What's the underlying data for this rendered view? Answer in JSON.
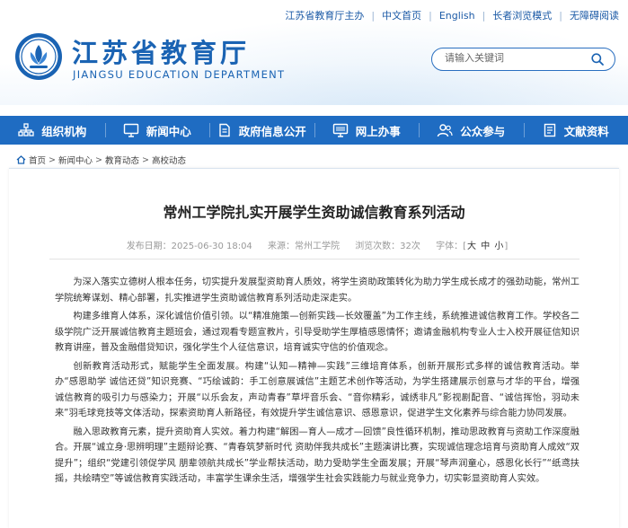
{
  "header": {
    "toplinks": [
      "江苏省教育厅主办",
      "中文首页",
      "English",
      "长者浏览模式",
      "无障碍阅读"
    ],
    "title_cn": "江苏省教育厅",
    "title_en": "JIANGSU EDUCATION DEPARTMENT",
    "search_placeholder": "请输入关键词"
  },
  "nav": {
    "items": [
      {
        "label": "组织机构",
        "icon": "org-chart-icon"
      },
      {
        "label": "新闻中心",
        "icon": "monitor-icon"
      },
      {
        "label": "政府信息公开",
        "icon": "document-icon"
      },
      {
        "label": "网上办事",
        "icon": "screen-icon"
      },
      {
        "label": "公众参与",
        "icon": "people-icon"
      },
      {
        "label": "文献资料",
        "icon": "book-icon"
      }
    ]
  },
  "breadcrumb": {
    "items": [
      "首页",
      "新闻中心",
      "教育动态",
      "高校动态"
    ],
    "separator": ">"
  },
  "article": {
    "title": "常州工学院扎实开展学生资助诚信教育系列活动",
    "date": "发布日期：2025-06-30 18:04",
    "source": "来源：常州工学院",
    "views": "浏览次数：32次",
    "font_label": "字体：[",
    "font_sizes": [
      "大",
      "中",
      "小"
    ],
    "font_close": "]",
    "paragraphs": [
      "为深入落实立德树人根本任务，切实提升发展型资助育人质效，将学生资助政策转化为助力学生成长成才的强劲动能，常州工学院统筹谋划、精心部署，扎实推进学生资助诚信教育系列活动走深走实。",
      "构建多维育人体系，深化诚信价值引领。以“精准施策—创新实践—长效覆盖”为工作主线，系统推进诚信教育工作。学校各二级学院广泛开展诚信教育主题班会，通过观看专题宣教片，引导受助学生厚植感恩情怀；邀请金融机构专业人士入校开展征信知识教育讲座，普及金融借贷知识，强化学生个人征信意识，培育诚实守信的价值观念。",
      "创新教育活动形式，赋能学生全面发展。构建“认知—精神—实践”三维培育体系，创新开展形式多样的诚信教育活动。举办“感恩助学 诚信还贷”知识竞赛、“巧绘诚韵：手工创意展诚信”主题艺术创作等活动，为学生搭建展示创意与才华的平台，增强诚信教育的吸引力与感染力；开展“以乐会友，声动青春”草坪音乐会、“音你精彩，诚绣非凡”影视剧配音、“诚信挥怡，羽动未来”羽毛球竞技等文体活动，探索资助育人新路径，有效提升学生诚信意识、感恩意识，促进学生文化素养与综合能力协同发展。",
      "融入思政教育元素，提升资助育人实效。着力构建“解困—育人—成才—回馈”良性循环机制，推动思政教育与资助工作深度融合。开展“诚立身·思辨明理”主题辩论赛、“青春筑梦新时代 资助伴我共成长”主题演讲比赛，实现诚信理念培育与资助育人成效“双提升”；组织“党建引领促学风 朋辈领航共成长”学业帮扶活动，助力受助学生全面发展；开展“琴声润童心，感恩化长行”“纸鸢扶摇，共绘晴空”等诚信教育实践活动，丰富学生课余生活，增强学生社会实践能力与就业竞争力，切实彰显资助育人实效。"
    ]
  },
  "colors": {
    "brand_blue": "#1f6cc2",
    "title_blue": "#1a63b3"
  }
}
